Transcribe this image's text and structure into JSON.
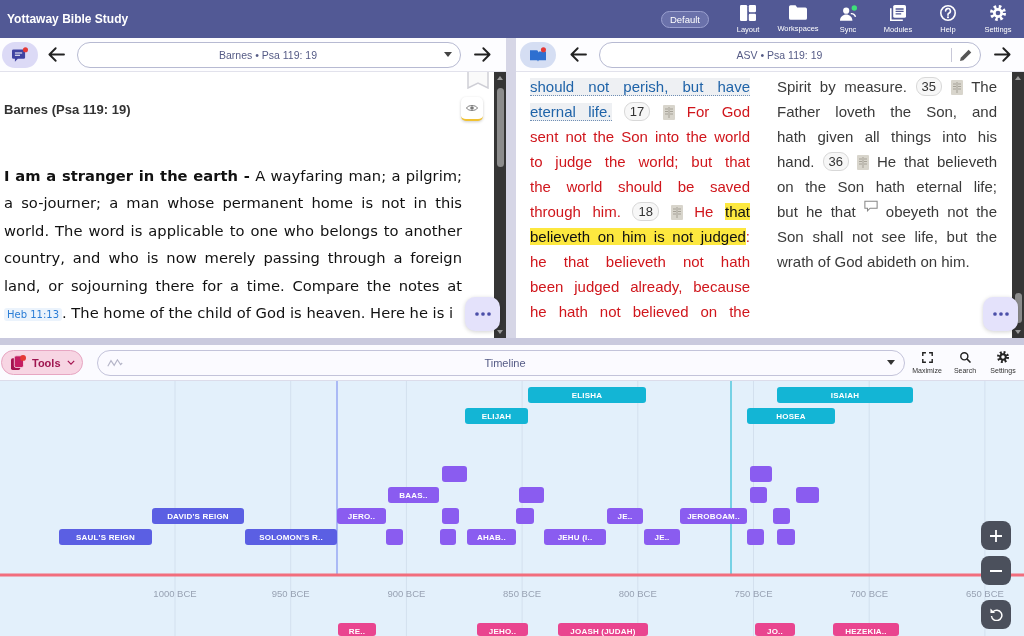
{
  "app_bar": {
    "title": "Yottaway Bible Study",
    "workspace": "Default",
    "actions": [
      {
        "kind": "layout",
        "label": "Layout"
      },
      {
        "kind": "workspaces",
        "label": "Workspaces"
      },
      {
        "kind": "sync",
        "label": "Sync"
      },
      {
        "kind": "modules",
        "label": "Modules"
      },
      {
        "kind": "help",
        "label": "Help"
      },
      {
        "kind": "settings",
        "label": "Settings"
      }
    ]
  },
  "commentary_pane": {
    "reference": "Barnes • Psa 119: 19",
    "heading": "Barnes (Psa 119: 19)",
    "text": "**I am a stranger in the earth -** A wayfaring man; a pilgrim; a so-journer; a man whose permanent home is not in this world. The word is applicable to one who belongs to another country, and who is now merely passing through a foreign land, or sojourning there for a time. Compare the notes at",
    "link": "Heb 11:13",
    "text_after": ". The home of the child of God is heaven. Here he is i"
  },
  "bible_pane": {
    "reference": "ASV • Psa 119: 19",
    "columns": [
      {
        "lines": [
          [
            {
              "kind": "marked",
              "text": "should not perish, but have"
            }
          ],
          [
            {
              "kind": "marked",
              "text": "eternal life."
            },
            {
              "kind": "verse",
              "number": "17"
            },
            {
              "kind": "words",
              "red_letter": true,
              "text": "For God"
            }
          ],
          [
            {
              "kind": "words",
              "red_letter": true,
              "text": "sent not the Son into the world"
            }
          ],
          [
            {
              "kind": "words",
              "red_letter": true,
              "text": "to judge the world; but that"
            }
          ],
          [
            {
              "kind": "words",
              "red_letter": true,
              "text": "the world should be saved"
            }
          ],
          [
            {
              "kind": "words",
              "red_letter": true,
              "text": "through him."
            },
            {
              "kind": "verse",
              "number": "18"
            },
            {
              "kind": "words",
              "red_letter": true,
              "text": "He"
            },
            {
              "kind": "highlight",
              "text": "that"
            }
          ],
          [
            {
              "kind": "highlight",
              "text": "believeth on him is not judged"
            },
            {
              "kind": "words",
              "red_letter": true,
              "attached": true,
              "text": ":"
            }
          ],
          [
            {
              "kind": "words",
              "red_letter": true,
              "text": "he that believeth not hath"
            }
          ],
          [
            {
              "kind": "words",
              "red_letter": true,
              "text": "been judged already, because"
            }
          ],
          [
            {
              "kind": "words",
              "red_letter": true,
              "text": "he hath not believed on the"
            }
          ]
        ]
      },
      {
        "lines": [
          [
            {
              "kind": "words",
              "red_letter": false,
              "text": "Spirit by measure."
            },
            {
              "kind": "verse",
              "number": "35"
            },
            {
              "kind": "words",
              "red_letter": false,
              "text": "The"
            }
          ],
          [
            {
              "kind": "words",
              "red_letter": false,
              "text": "Father loveth the Son, and"
            }
          ],
          [
            {
              "kind": "words",
              "red_letter": false,
              "text": "hath given all things into his"
            }
          ],
          [
            {
              "kind": "words",
              "red_letter": false,
              "text": "hand."
            },
            {
              "kind": "verse",
              "number": "36"
            },
            {
              "kind": "words",
              "red_letter": false,
              "text": "He that believeth"
            }
          ],
          [
            {
              "kind": "words",
              "red_letter": false,
              "text": "on the Son hath eternal life;"
            }
          ],
          [
            {
              "kind": "words",
              "red_letter": false,
              "text": "but he that"
            },
            {
              "kind": "note"
            },
            {
              "kind": "words",
              "red_letter": false,
              "text": "obeyeth not the"
            }
          ],
          [
            {
              "kind": "words",
              "red_letter": false,
              "text": "Son shall not see life, but the"
            }
          ],
          [
            {
              "kind": "words",
              "red_letter": false,
              "text": "wrath of God abideth on him."
            }
          ]
        ]
      }
    ]
  },
  "tools_bar": {
    "label": "Tools",
    "view": "Timeline",
    "actions": [
      {
        "kind": "maximize",
        "label": "Maximize"
      },
      {
        "kind": "search",
        "label": "Search"
      },
      {
        "kind": "settings",
        "label": "Settings"
      }
    ]
  },
  "timeline": {
    "ticks": [
      "1000 BCE",
      "950 BCE",
      "900 BCE",
      "850 BCE",
      "800 BCE",
      "750 BCE",
      "700 BCE",
      "650 BCE"
    ],
    "events": [
      {
        "label": "ELISHA",
        "color": "#13b5d5"
      },
      {
        "label": "ISAIAH",
        "color": "#13b5d5"
      },
      {
        "label": "ELIJAH",
        "color": "#13b5d5"
      },
      {
        "label": "HOSEA",
        "color": "#13b5d5"
      },
      {
        "color": "#8a5cf0"
      },
      {
        "color": "#8a5cf0"
      },
      {
        "label": "BAAS..",
        "color": "#8a5cf0"
      },
      {
        "color": "#8a5cf0"
      },
      {
        "color": "#8a5cf0"
      },
      {
        "color": "#8a5cf0"
      },
      {
        "label": "DAVID'S REIGN",
        "color": "#5b5fe3"
      },
      {
        "label": "JERO..",
        "color": "#8a5cf0"
      },
      {
        "color": "#8a5cf0"
      },
      {
        "color": "#8a5cf0"
      },
      {
        "label": "JE..",
        "color": "#8a5cf0"
      },
      {
        "label": "JEROBOAM..",
        "color": "#8a5cf0"
      },
      {
        "color": "#8a5cf0"
      },
      {
        "label": "SAUL'S REIGN",
        "color": "#5b5fe3"
      },
      {
        "label": "SOLOMON'S R..",
        "color": "#5b5fe3"
      },
      {
        "color": "#8a5cf0"
      },
      {
        "color": "#8a5cf0"
      },
      {
        "label": "AHAB..",
        "color": "#8a5cf0"
      },
      {
        "label": "JEHU (I..",
        "color": "#8a5cf0"
      },
      {
        "label": "JE..",
        "color": "#8a5cf0"
      },
      {
        "color": "#8a5cf0"
      },
      {
        "color": "#8a5cf0"
      },
      {
        "label": "RE..",
        "color": "#e9458f"
      },
      {
        "label": "JEHO..",
        "color": "#e9458f"
      },
      {
        "label": "JOASH (JUDAH)",
        "color": "#e9458f"
      },
      {
        "label": "JO..",
        "color": "#e9458f"
      },
      {
        "label": "HEZEKIA..",
        "color": "#e9458f"
      }
    ]
  }
}
